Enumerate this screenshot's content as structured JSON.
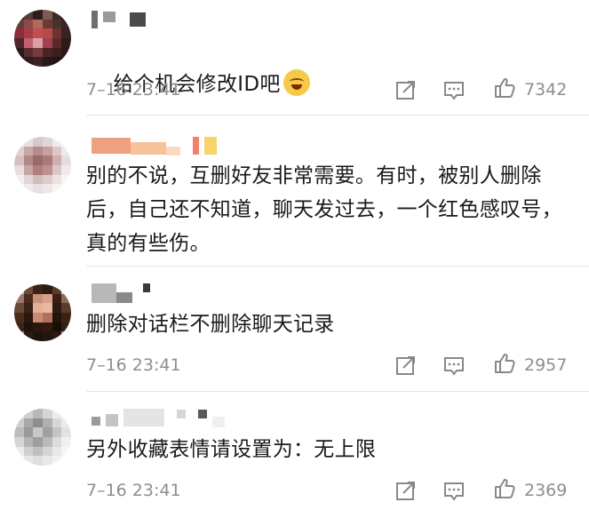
{
  "comments": [
    {
      "text": "给个机会修改ID吧",
      "emoji": "laughing-crying-emoji",
      "time": "7–16 23:41",
      "likes": "7342"
    },
    {
      "text": "别的不说，互删好友非常需要。有时，被别人删除后，自己还不知道，聊天发过去，一个红色感叹号，真的有些伤。",
      "time": "",
      "likes": ""
    },
    {
      "text": "删除对话栏不删除聊天记录",
      "time": "7–16 23:41",
      "likes": "2957"
    },
    {
      "text": "另外收藏表情请设置为：无上限",
      "time": "7–16 23:41",
      "likes": "2369"
    }
  ],
  "icons": {
    "repost": "repost-icon",
    "comment": "comment-icon",
    "like": "thumbs-up-icon"
  }
}
